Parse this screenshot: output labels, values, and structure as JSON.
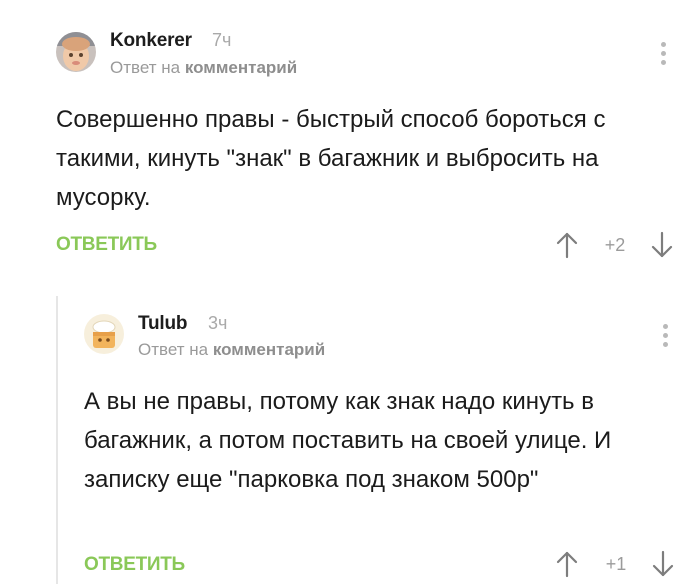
{
  "comments": [
    {
      "author": "Konkerer",
      "time": "7ч",
      "reply_prefix": "Ответ на",
      "reply_link": "комментарий",
      "text": "Совершенно правы - быстрый способ бороться с такими, кинуть \"знак\" в багажник и выбросить на мусорку.",
      "reply_label": "ОТВЕТИТЬ",
      "rating": "+2",
      "avatar_icon": "user-photo-avatar",
      "more_icon": "vertical-dots-icon"
    },
    {
      "author": "Tulub",
      "time": "3ч",
      "reply_prefix": "Ответ на",
      "reply_link": "комментарий",
      "text": "А вы не правы, потому как знак надо кинуть в багажник, а потом поставить на своей улице. И записку еще \"парковка под знаком 500р\"",
      "reply_label": "ОТВЕТИТЬ",
      "rating": "+1",
      "avatar_icon": "cartoon-avatar",
      "more_icon": "vertical-dots-icon"
    }
  ],
  "colors": {
    "accent_green": "#8ac858",
    "muted_gray": "#9a9a9a",
    "thread_line": "#e6e6e6"
  }
}
